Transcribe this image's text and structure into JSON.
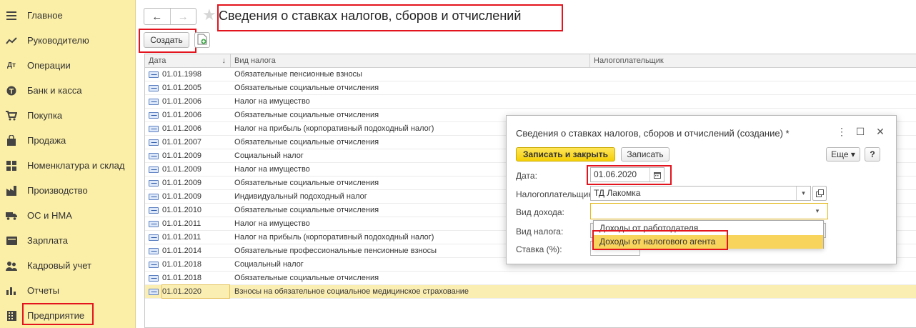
{
  "sidebar": {
    "items": [
      {
        "label": "Главное",
        "icon": "menu-icon"
      },
      {
        "label": "Руководителю",
        "icon": "trend-icon"
      },
      {
        "label": "Операции",
        "icon": "operations-icon"
      },
      {
        "label": "Банк и касса",
        "icon": "money-icon"
      },
      {
        "label": "Покупка",
        "icon": "cart-icon"
      },
      {
        "label": "Продажа",
        "icon": "bag-icon"
      },
      {
        "label": "Номенклатура и склад",
        "icon": "grid-icon"
      },
      {
        "label": "Производство",
        "icon": "factory-icon"
      },
      {
        "label": "ОС и НМА",
        "icon": "truck-icon"
      },
      {
        "label": "Зарплата",
        "icon": "wallet-icon"
      },
      {
        "label": "Кадровый учет",
        "icon": "people-icon"
      },
      {
        "label": "Отчеты",
        "icon": "bar-chart-icon"
      },
      {
        "label": "Предприятие",
        "icon": "building-icon"
      }
    ]
  },
  "header": {
    "title": "Сведения о ставках налогов, сборов и отчислений",
    "back_icon": "←",
    "forward_icon": "→",
    "star_icon": "★"
  },
  "toolbar": {
    "create_label": "Создать"
  },
  "table": {
    "columns": [
      "Дата",
      "Вид налога",
      "Налогоплательщик"
    ],
    "sort_indicator": "↓",
    "rows": [
      {
        "date": "01.01.1998",
        "tax": "Обязательные пенсионные взносы"
      },
      {
        "date": "01.01.2005",
        "tax": "Обязательные социальные отчисления"
      },
      {
        "date": "01.01.2006",
        "tax": "Налог на имущество"
      },
      {
        "date": "01.01.2006",
        "tax": "Обязательные социальные отчисления"
      },
      {
        "date": "01.01.2006",
        "tax": "Налог на прибыль (корпоративный подоходный налог)"
      },
      {
        "date": "01.01.2007",
        "tax": "Обязательные социальные отчисления"
      },
      {
        "date": "01.01.2009",
        "tax": "Социальный налог"
      },
      {
        "date": "01.01.2009",
        "tax": "Налог на имущество"
      },
      {
        "date": "01.01.2009",
        "tax": "Обязательные социальные отчисления"
      },
      {
        "date": "01.01.2009",
        "tax": "Индивидуальный подоходный налог"
      },
      {
        "date": "01.01.2010",
        "tax": "Обязательные социальные отчисления"
      },
      {
        "date": "01.01.2011",
        "tax": "Налог на имущество"
      },
      {
        "date": "01.01.2011",
        "tax": "Налог на прибыль (корпоративный подоходный налог)"
      },
      {
        "date": "01.01.2014",
        "tax": "Обязательные профессиональные пенсионные взносы"
      },
      {
        "date": "01.01.2018",
        "tax": "Социальный налог"
      },
      {
        "date": "01.01.2018",
        "tax": "Обязательные социальные отчисления"
      },
      {
        "date": "01.01.2020",
        "tax": "Взносы на обязательное социальное медицинское страхование"
      }
    ]
  },
  "dialog": {
    "title": "Сведения о ставках налогов, сборов и отчислений (создание) *",
    "save_close_label": "Записать и закрыть",
    "save_label": "Записать",
    "more_label": "Еще ▾",
    "help_label": "?",
    "date_label": "Дата:",
    "date_value": "01.06.2020",
    "payer_label": "Налогоплательщик:",
    "payer_value": "ТД Лакомка",
    "income_label": "Вид дохода:",
    "income_value": "",
    "tax_label": "Вид налога:",
    "rate_label": "Ставка (%):",
    "dropdown_items": [
      "Доходы от работодателя",
      "Доходы от налогового агента"
    ]
  },
  "colors": {
    "sidebar_bg": "#fbeea6",
    "accent_yellow": "#f5cf08",
    "highlight_red": "#e3141d",
    "selected_row": "#fbeeb3"
  }
}
